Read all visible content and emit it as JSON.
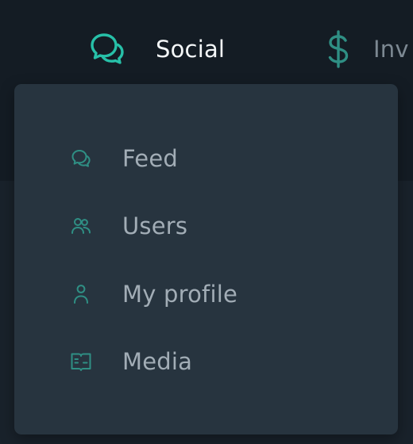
{
  "colors": {
    "accent": "#27c0a8",
    "accent_muted": "#2f8f84",
    "nav_active_text": "#f4f7f8",
    "nav_inactive_text": "#7c8892",
    "menu_text": "#a2adb6",
    "menu_bg": "#27343f",
    "topbar_bg": "#141c24"
  },
  "nav": {
    "social": {
      "label": "Social",
      "icon": "chat-bubbles-icon"
    },
    "invest": {
      "label": "Inv",
      "icon": "dollar-icon"
    }
  },
  "menu": {
    "items": [
      {
        "label": "Feed",
        "icon": "chat-bubbles-icon"
      },
      {
        "label": "Users",
        "icon": "users-icon"
      },
      {
        "label": "My profile",
        "icon": "user-icon"
      },
      {
        "label": "Media",
        "icon": "book-icon"
      }
    ]
  }
}
